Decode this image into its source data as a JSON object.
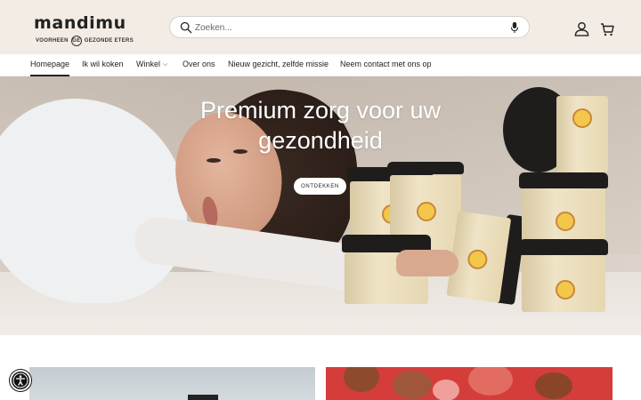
{
  "header": {
    "logo_word": "mandimu",
    "logo_sub_prefix": "VOORHEEN",
    "logo_sub_suffix": "GEZONDE ETERS",
    "logo_badge": "GE",
    "background": "#f3ece4"
  },
  "search": {
    "placeholder": "Zoeken...",
    "value": ""
  },
  "icons": {
    "search": "search-icon",
    "mic": "microphone-icon",
    "account": "account-icon",
    "cart": "cart-icon",
    "chevron": "chevron-down-icon",
    "accessibility": "accessibility-icon"
  },
  "nav": {
    "items": [
      {
        "label": "Homepage",
        "active": true
      },
      {
        "label": "Ik wil koken"
      },
      {
        "label": "Winkel",
        "has_dropdown": true
      },
      {
        "label": "Over ons"
      },
      {
        "label": "Nieuw gezicht, zelfde missie"
      },
      {
        "label": "Neem contact met ons op"
      }
    ]
  },
  "hero": {
    "title_line1": "Premium zorg voor uw",
    "title_line2": "gezondheid",
    "button_label": "ONTDEKKEN"
  },
  "colors": {
    "text": "#222222",
    "card_right": "#d43d3a"
  }
}
